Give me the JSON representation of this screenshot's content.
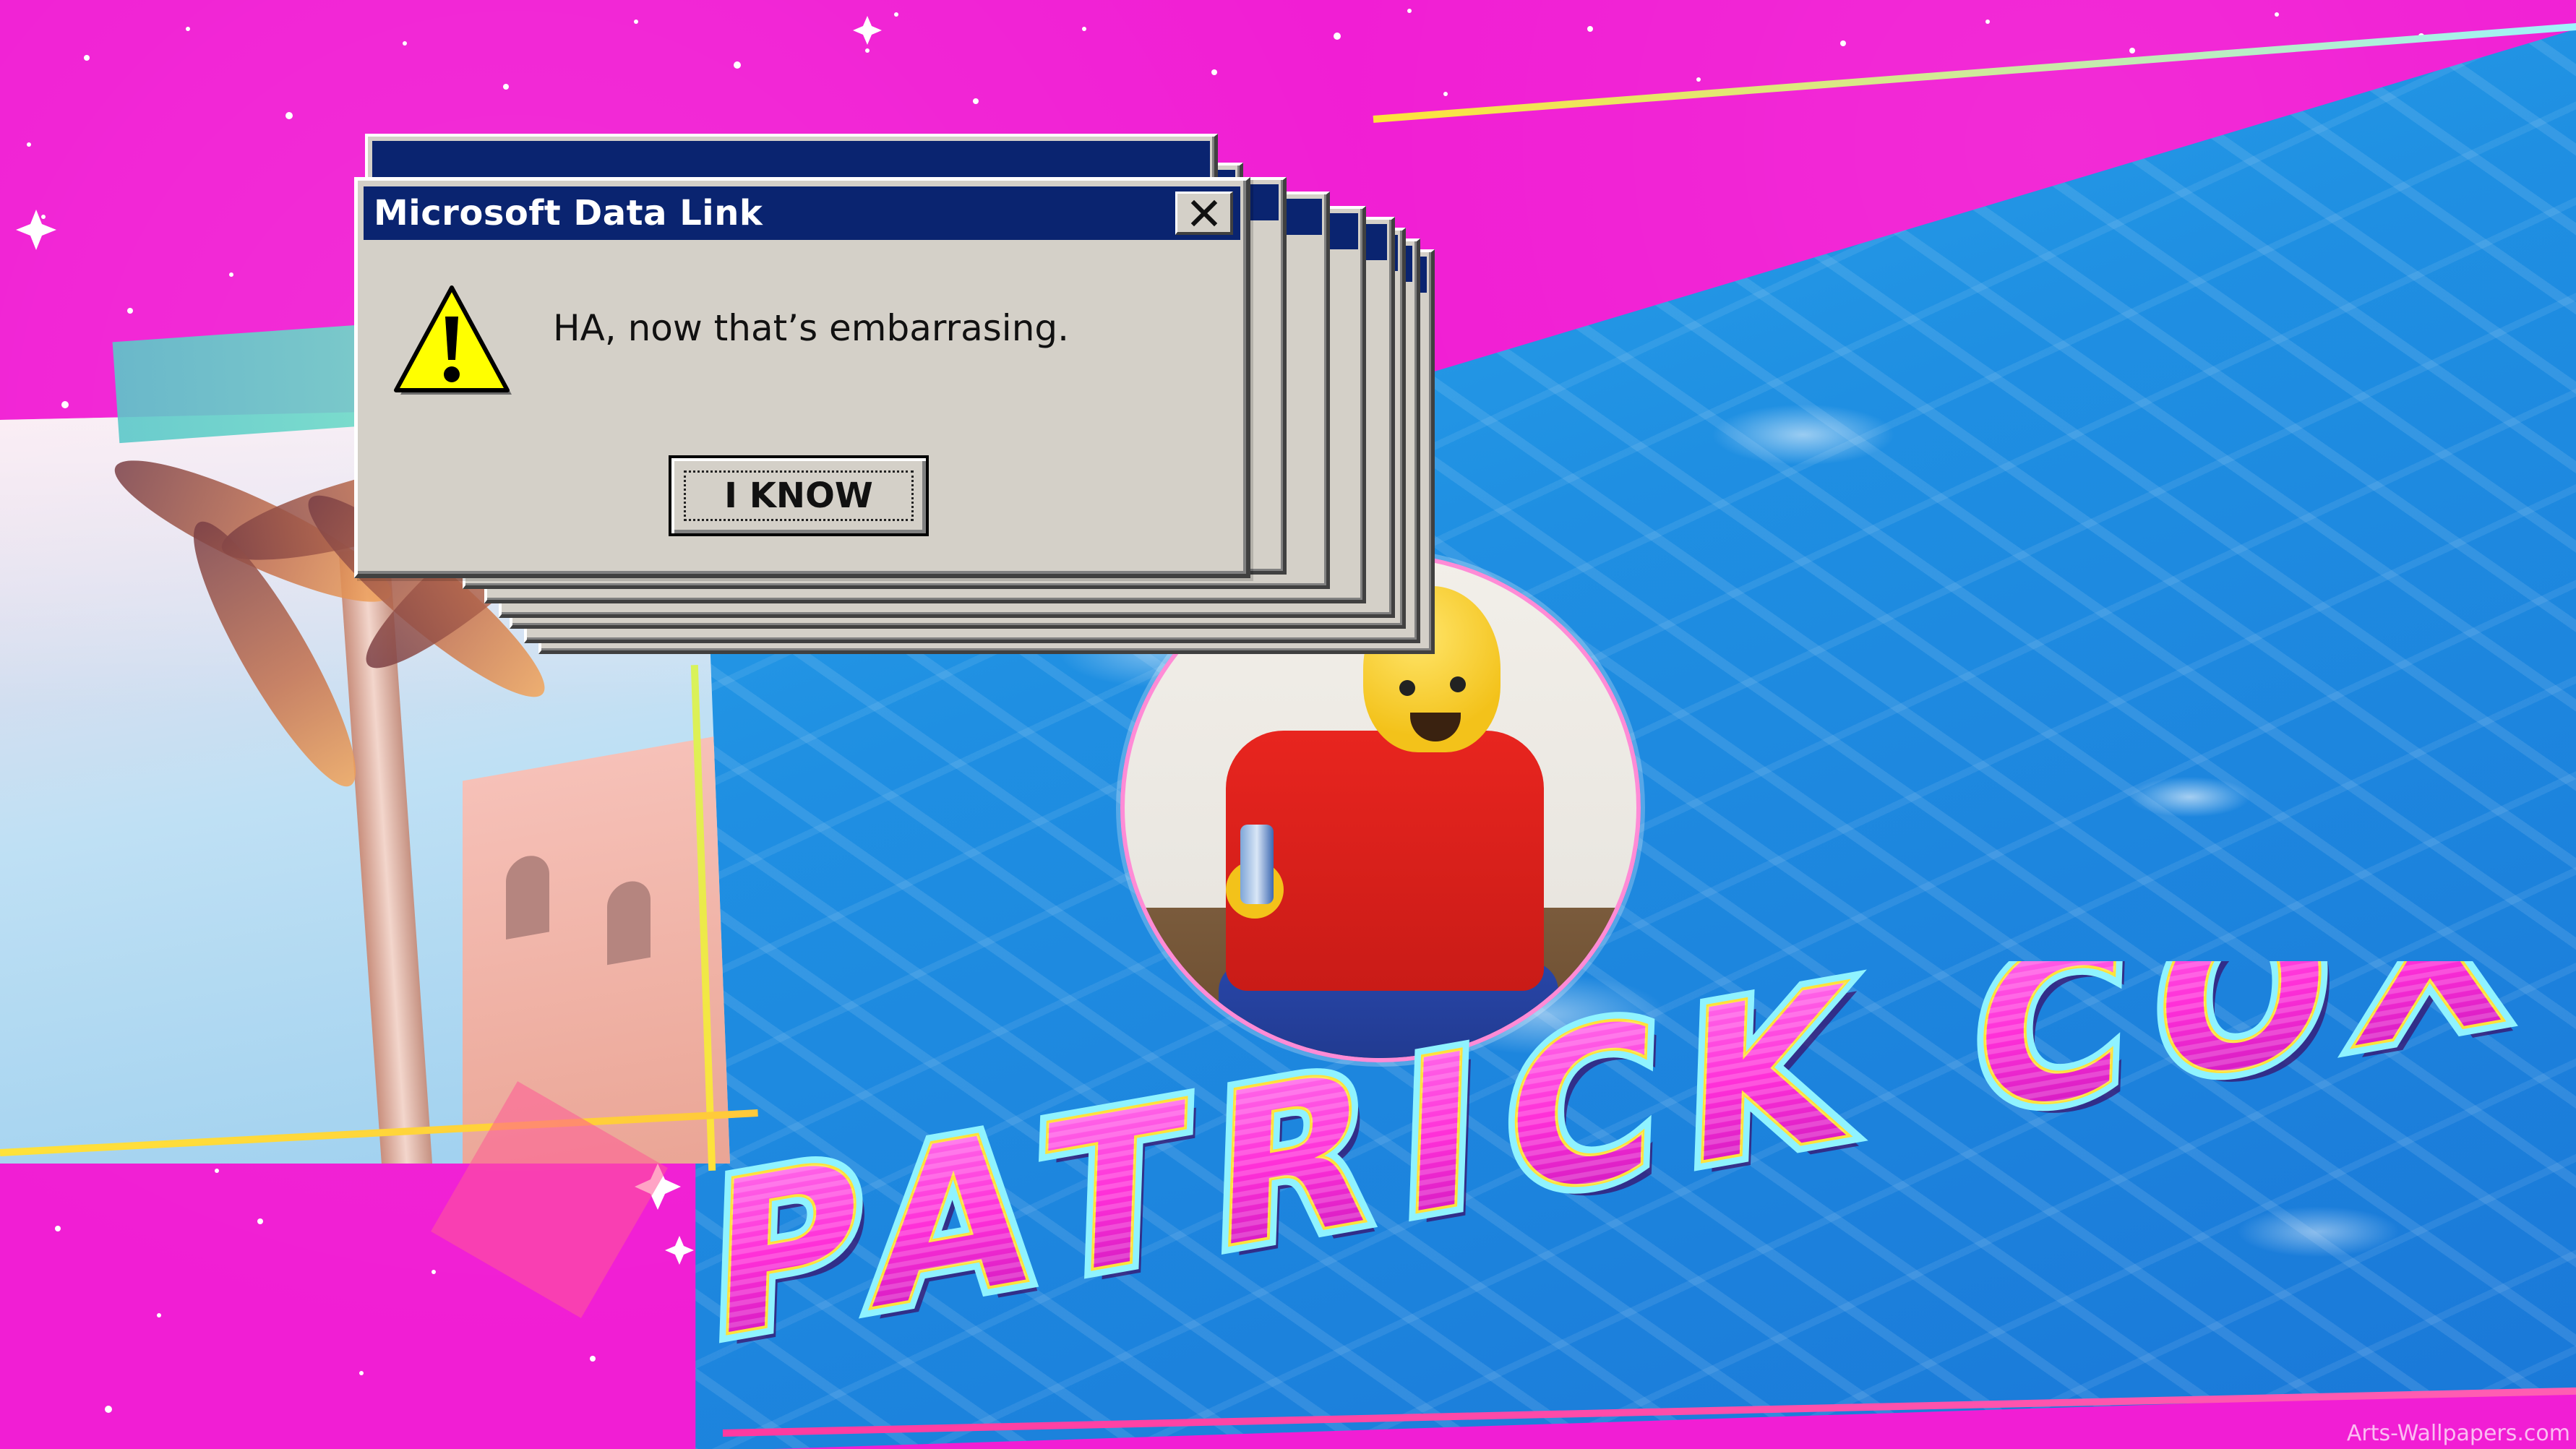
{
  "dialog": {
    "title": "Microsoft Data Link",
    "message": "HA, now that’s embarrasing.",
    "button_label": "I KNOW",
    "close_glyph": "✕",
    "icon": "warning-icon"
  },
  "wallpaper": {
    "title_text": "PATRICK COX",
    "watermark": "Arts-Wallpapers.com"
  },
  "colors": {
    "background": "#f11ed4",
    "titlebar": "#0a2470",
    "window_face": "#d4d0c8",
    "title_fill": "#ff3de0",
    "title_outline": "#8ff3ff",
    "water": "#1f8fe2"
  }
}
